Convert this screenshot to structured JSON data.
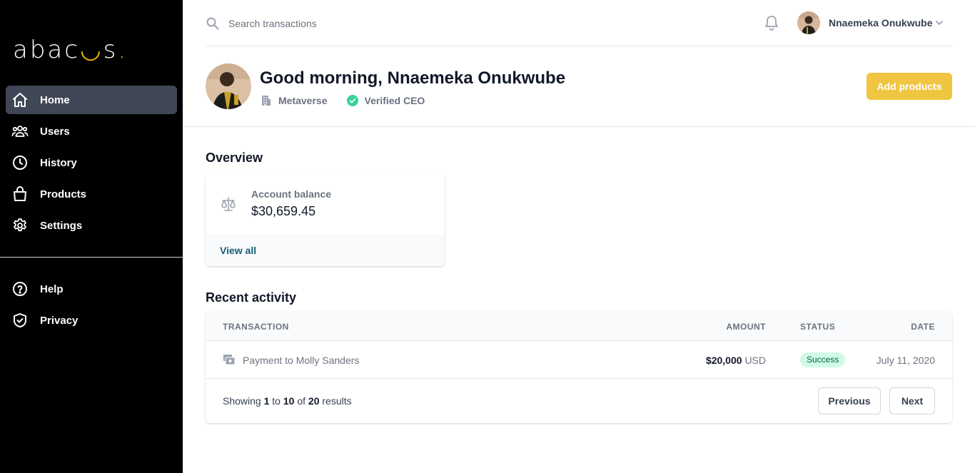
{
  "brand": {
    "logo_pre": "abac",
    "logo_smile": "◡",
    "logo_post": "s",
    "logo_dot": ".",
    "accent": "#eab308"
  },
  "sidebar": {
    "items": [
      {
        "label": "Home",
        "icon": "home-icon",
        "active": true
      },
      {
        "label": "Users",
        "icon": "users-icon"
      },
      {
        "label": "History",
        "icon": "clock-icon"
      },
      {
        "label": "Products",
        "icon": "shopping-bag-icon"
      },
      {
        "label": "Settings",
        "icon": "gear-icon"
      }
    ],
    "secondary": [
      {
        "label": "Help",
        "icon": "question-circle-icon"
      },
      {
        "label": "Privacy",
        "icon": "shield-check-icon"
      }
    ]
  },
  "topbar": {
    "search_placeholder": "Search transactions",
    "user_name": "Nnaemeka Onukwube"
  },
  "header": {
    "greeting": "Good morning, Nnaemeka Onukwube",
    "company": "Metaverse",
    "role": "Verified CEO",
    "add_button": "Add products",
    "add_button_color": "#f0c541"
  },
  "overview": {
    "title": "Overview",
    "card_label": "Account balance",
    "card_value": "$30,659.45",
    "view_all": "View all"
  },
  "activity": {
    "title": "Recent activity",
    "columns": [
      "TRANSACTION",
      "AMOUNT",
      "STATUS",
      "DATE"
    ],
    "rows": [
      {
        "name": "Payment to Molly Sanders",
        "amount": "$20,000",
        "currency": "USD",
        "status": "Success",
        "date": "July 11, 2020"
      }
    ],
    "pagination": {
      "showing": "Showing",
      "from": "1",
      "to_word": "to",
      "to": "10",
      "of_word": "of",
      "total": "20",
      "results_word": "results",
      "prev": "Previous",
      "next": "Next"
    }
  }
}
